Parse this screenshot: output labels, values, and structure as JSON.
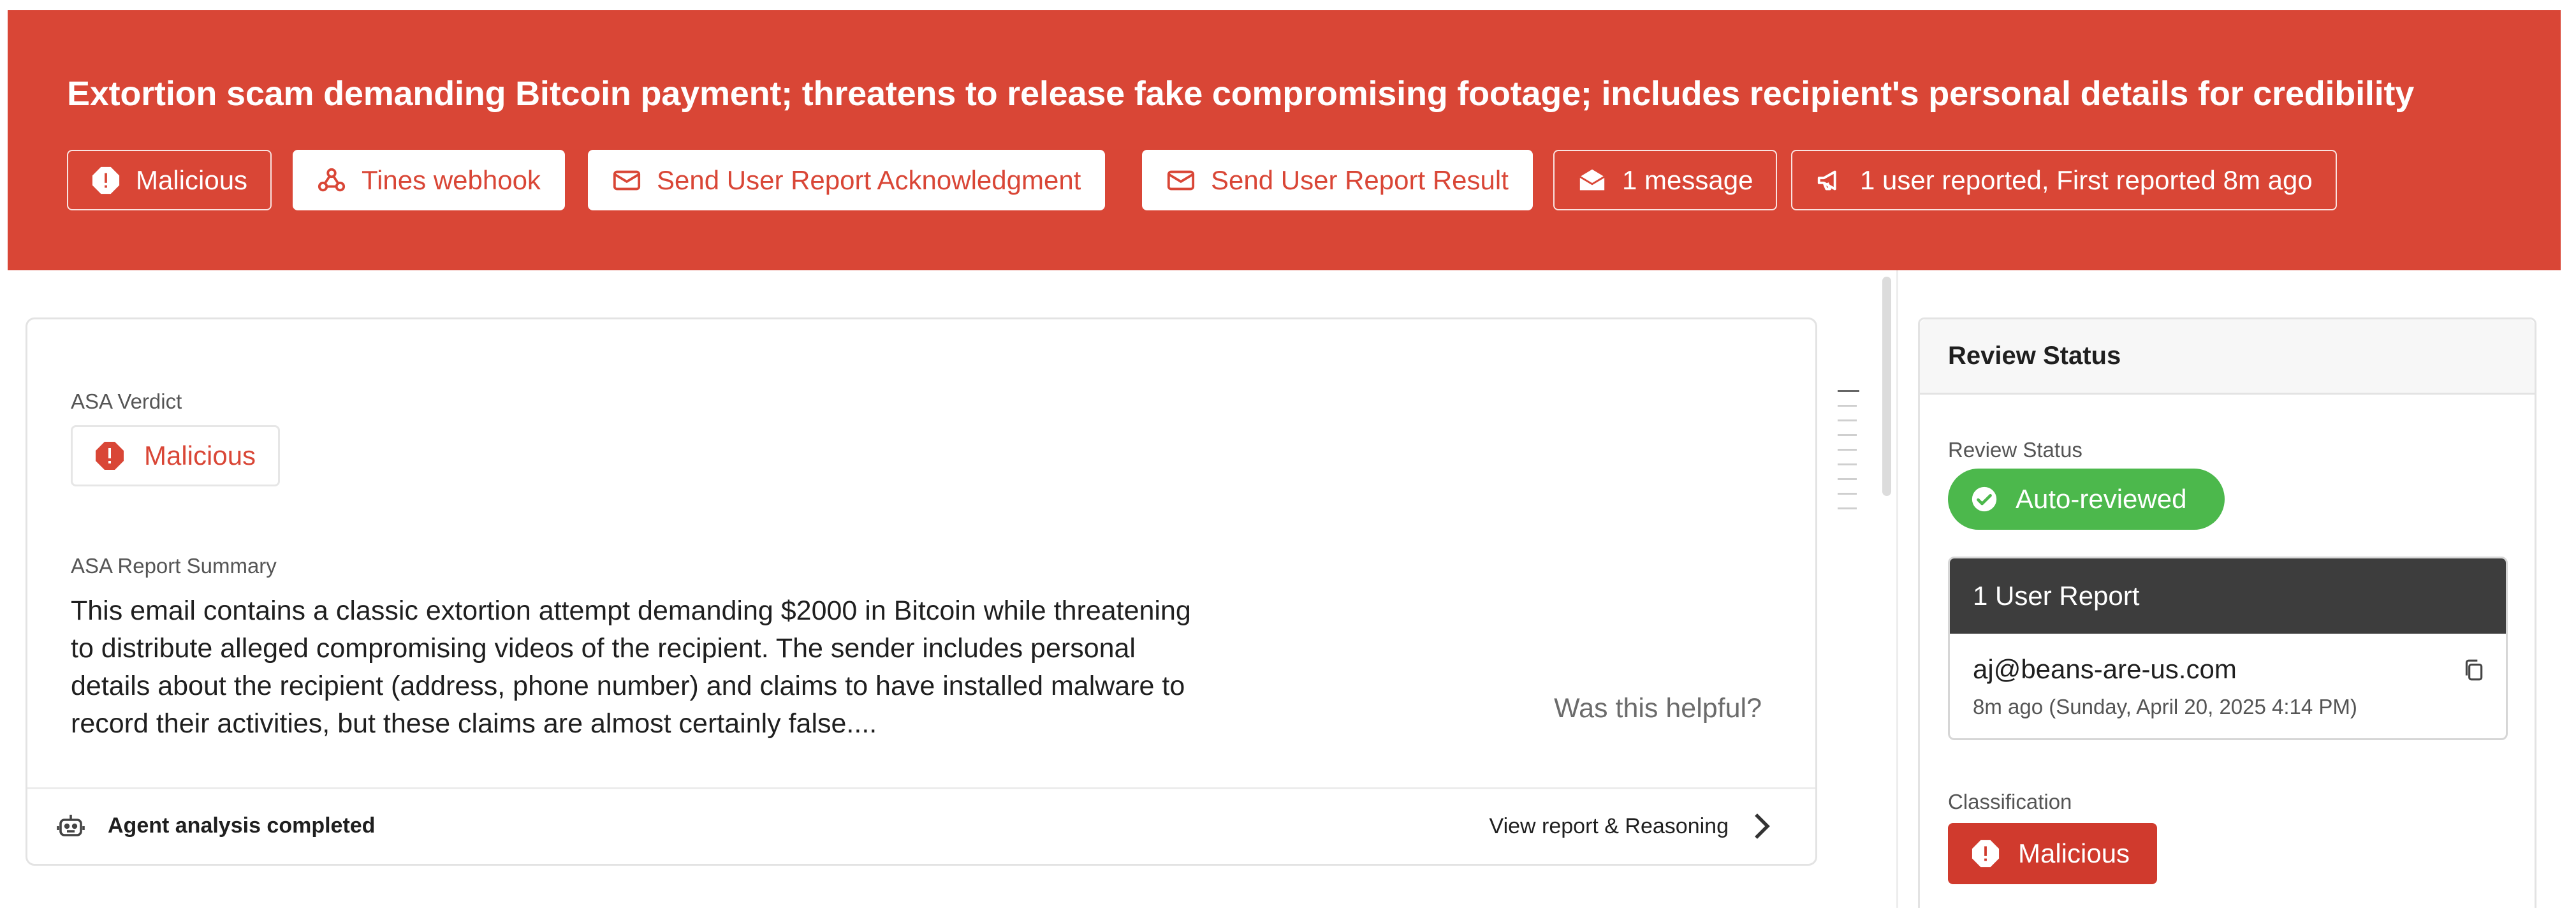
{
  "header": {
    "title": "Extortion scam demanding Bitcoin payment; threatens to release fake compromising footage; includes recipient's personal details for credibility",
    "background_color": "#d94636",
    "pills": [
      {
        "label": "Malicious",
        "icon": "alert-octagon-icon",
        "style": "outline"
      },
      {
        "label": "Tines webhook",
        "icon": "webhook-icon",
        "style": "solid"
      },
      {
        "label": "Send User Report Acknowledgment",
        "icon": "envelope-icon",
        "style": "solid"
      },
      {
        "label": "Send User Report Result",
        "icon": "envelope-icon",
        "style": "solid"
      },
      {
        "label": "1 message",
        "icon": "envelope-open-icon",
        "style": "outline"
      },
      {
        "label": "1 user reported, First reported 8m ago",
        "icon": "megaphone-icon",
        "style": "outline"
      }
    ]
  },
  "main": {
    "verdict_label": "ASA Verdict",
    "verdict_value": "Malicious",
    "summary_label": "ASA Report Summary",
    "summary_text": "This email contains a classic extortion attempt demanding $2000 in Bitcoin while threatening to distribute alleged compromising videos of the recipient. The sender includes personal details about the recipient (address, phone number) and claims to have installed malware to record their activities, but these claims are almost certainly false....",
    "helpful_text": "Was this helpful?",
    "footer": {
      "status": "Agent analysis completed",
      "link": "View report & Reasoning"
    }
  },
  "side": {
    "title": "Review Status",
    "status_label": "Review Status",
    "status_value": "Auto-reviewed",
    "status_color": "#4cb84c",
    "user_report": {
      "header": "1 User Report",
      "email": "aj@beans-are-us.com",
      "when": "8m ago (Sunday, April 20, 2025 4:14 PM)"
    },
    "classification_label": "Classification",
    "classification_value": "Malicious",
    "classification_color": "#d03a2d"
  }
}
